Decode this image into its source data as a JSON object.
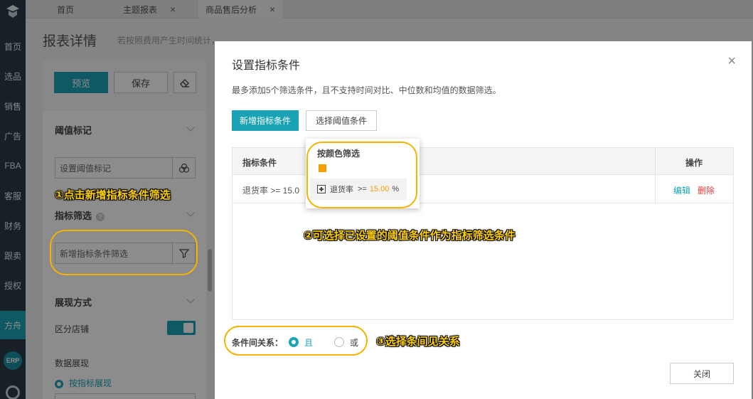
{
  "sidebar": {
    "items": [
      "首页",
      "选品",
      "销售",
      "广告",
      "FBA",
      "客服",
      "财务",
      "跟卖",
      "授权",
      "方舟"
    ],
    "erp_label": "ERP",
    "active_color": "#1aa3b4"
  },
  "tabs": [
    {
      "label": "首页",
      "closable": false
    },
    {
      "label": "主题报表",
      "closable": true
    },
    {
      "label": "商品售后分析",
      "closable": true
    }
  ],
  "page": {
    "title": "报表详情",
    "description": "若按照费用产生时间统计，则数据与亚马逊后台payment付款数据相对应，偏向财务分析。"
  },
  "panel": {
    "preview_label": "预览",
    "save_label": "保存",
    "threshold_title": "阈值标记",
    "threshold_placeholder": "设置阈值标记",
    "filter_title": "指标筛选",
    "filter_placeholder": "新增指标条件筛选",
    "display_title": "展现方式",
    "split_store_label": "区分店铺",
    "split_store_on": true,
    "data_display_label": "数据展现",
    "by_metric_label": "按指标展现"
  },
  "modal": {
    "title": "设置指标条件",
    "hint": "最多添加5个筛选条件，且不支持时间对比、中位数和均值的数据筛选。",
    "add_button": "新增指标条件",
    "choose_button": "选择阈值条件",
    "table": {
      "col_condition": "指标条件",
      "col_action": "操作",
      "rows": [
        {
          "condition": "退货率 >= 15.0",
          "edit": "编辑",
          "delete": "删除"
        }
      ]
    },
    "relation_label": "条件间关系：",
    "relation_and": "且",
    "relation_or": "或",
    "relation_selected": "且",
    "close_button": "关闭"
  },
  "popover": {
    "title": "按颜色筛选",
    "swatch_color": "#f5a000",
    "item_metric": "退货率",
    "item_op": ">=",
    "item_value": "15.00",
    "item_unit": "%"
  },
  "annotations": {
    "step1": "①点击新增指标条件筛选",
    "step2": "②可选择已设置的阈值条件作为指标筛选条件",
    "step3": "③选择条间见关系",
    "color": "#f5b300"
  }
}
